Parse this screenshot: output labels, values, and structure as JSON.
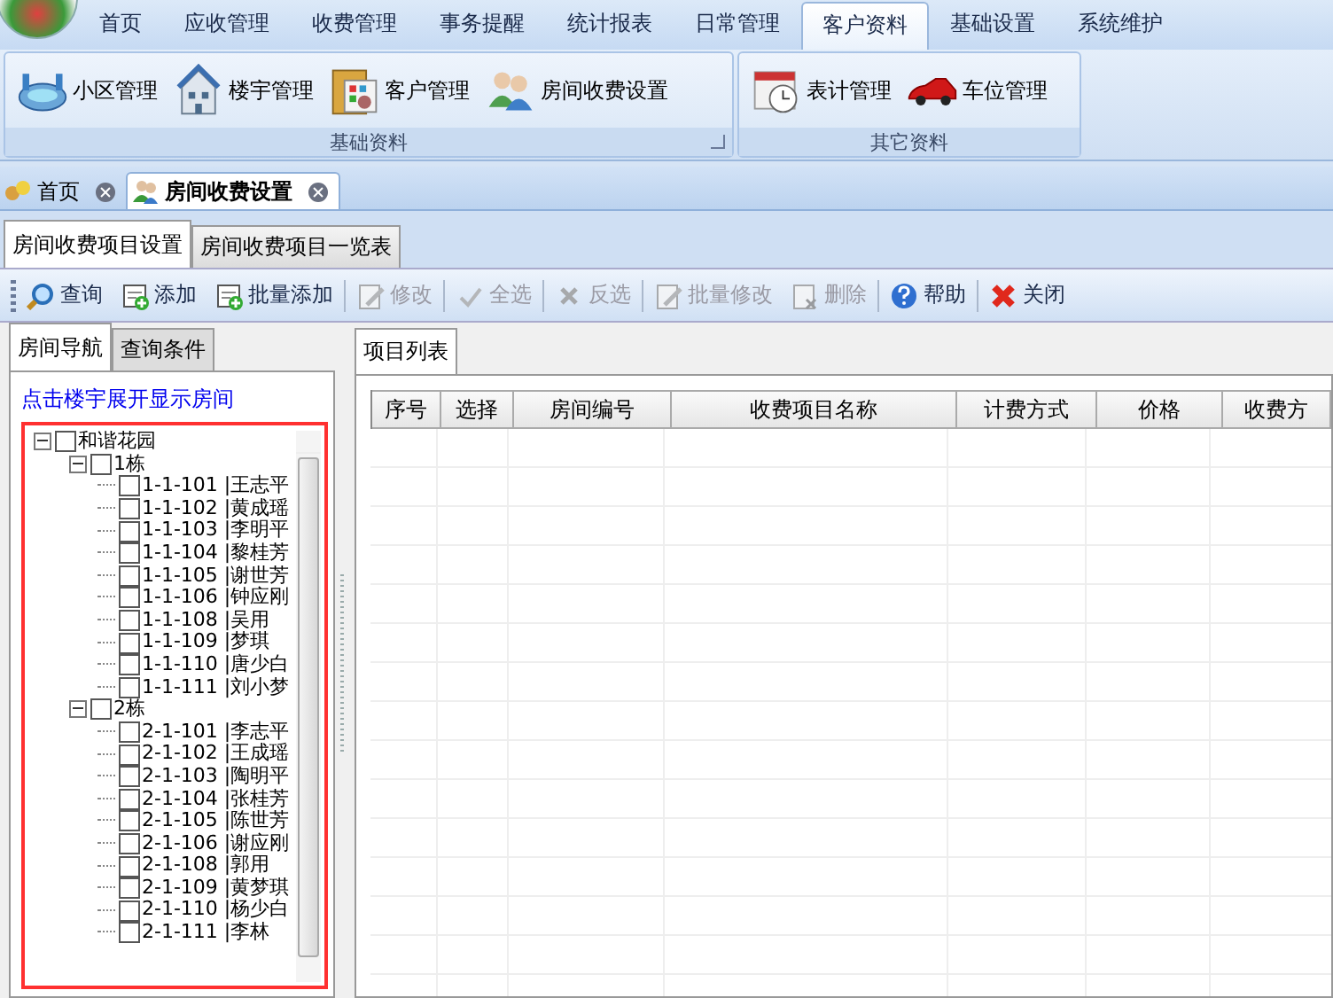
{
  "menu_tabs": [
    {
      "label": "首页",
      "selected": false
    },
    {
      "label": "应收管理",
      "selected": false
    },
    {
      "label": "收费管理",
      "selected": false
    },
    {
      "label": "事务提醒",
      "selected": false
    },
    {
      "label": "统计报表",
      "selected": false
    },
    {
      "label": "日常管理",
      "selected": false
    },
    {
      "label": "客户资料",
      "selected": true
    },
    {
      "label": "基础设置",
      "selected": false
    },
    {
      "label": "系统维护",
      "selected": false
    }
  ],
  "ribbon_groups": [
    {
      "title": "基础资料",
      "launcher": true,
      "buttons": [
        {
          "label": "小区管理"
        },
        {
          "label": "楼宇管理"
        },
        {
          "label": "客户管理"
        },
        {
          "label": "房间收费设置"
        }
      ]
    },
    {
      "title": "其它资料",
      "launcher": false,
      "buttons": [
        {
          "label": "表计管理"
        },
        {
          "label": "车位管理"
        }
      ]
    }
  ],
  "doc_tabs": [
    {
      "label": "首页",
      "selected": false
    },
    {
      "label": "房间收费设置",
      "selected": true
    }
  ],
  "page_tabs": [
    {
      "label": "房间收费项目设置",
      "selected": true
    },
    {
      "label": "房间收费项目一览表",
      "selected": false
    }
  ],
  "toolbar": [
    {
      "label": "查询",
      "disabled": false
    },
    {
      "label": "添加",
      "disabled": false
    },
    {
      "label": "批量添加",
      "disabled": false
    },
    {
      "label": "修改",
      "disabled": true
    },
    {
      "label": "全选",
      "disabled": true
    },
    {
      "label": "反选",
      "disabled": true
    },
    {
      "label": "批量修改",
      "disabled": true
    },
    {
      "label": "删除",
      "disabled": true
    },
    {
      "label": "帮助",
      "disabled": false
    },
    {
      "label": "关闭",
      "disabled": false
    }
  ],
  "nav_tabs": [
    {
      "label": "房间导航",
      "selected": true
    },
    {
      "label": "查询条件",
      "selected": false
    }
  ],
  "nav_hint": "点击楼宇展开显示房间",
  "tree": [
    {
      "label": "和谐花园",
      "checked": false,
      "expanded": true,
      "children": [
        {
          "label": "1栋",
          "checked": false,
          "expanded": true,
          "children": [
            {
              "label": "1-1-101 |王志平",
              "checked": false
            },
            {
              "label": "1-1-102 |黄成瑶",
              "checked": false
            },
            {
              "label": "1-1-103 |李明平",
              "checked": false
            },
            {
              "label": "1-1-104 |黎桂芳",
              "checked": false
            },
            {
              "label": "1-1-105 |谢世芳",
              "checked": false
            },
            {
              "label": "1-1-106 |钟应刚",
              "checked": false
            },
            {
              "label": "1-1-108 |吴用",
              "checked": false
            },
            {
              "label": "1-1-109 |梦琪",
              "checked": false
            },
            {
              "label": "1-1-110 |唐少白",
              "checked": false
            },
            {
              "label": "1-1-111 |刘小梦",
              "checked": false
            }
          ]
        },
        {
          "label": "2栋",
          "checked": false,
          "expanded": true,
          "children": [
            {
              "label": "2-1-101 |李志平",
              "checked": false
            },
            {
              "label": "2-1-102 |王成瑶",
              "checked": false
            },
            {
              "label": "2-1-103 |陶明平",
              "checked": false
            },
            {
              "label": "2-1-104 |张桂芳",
              "checked": false
            },
            {
              "label": "2-1-105 |陈世芳",
              "checked": false
            },
            {
              "label": "2-1-106 |谢应刚",
              "checked": false
            },
            {
              "label": "2-1-108 |郭用",
              "checked": false
            },
            {
              "label": "2-1-109 |黄梦琪",
              "checked": false
            },
            {
              "label": "2-1-110 |杨少白",
              "checked": false
            },
            {
              "label": "2-1-111 |李林",
              "checked": false
            }
          ]
        }
      ]
    }
  ],
  "list_tab": {
    "label": "项目列表",
    "selected": true
  },
  "table": {
    "columns": [
      "序号",
      "选择",
      "房间编号",
      "收费项目名称",
      "计费方式",
      "价格",
      "收费方"
    ]
  }
}
